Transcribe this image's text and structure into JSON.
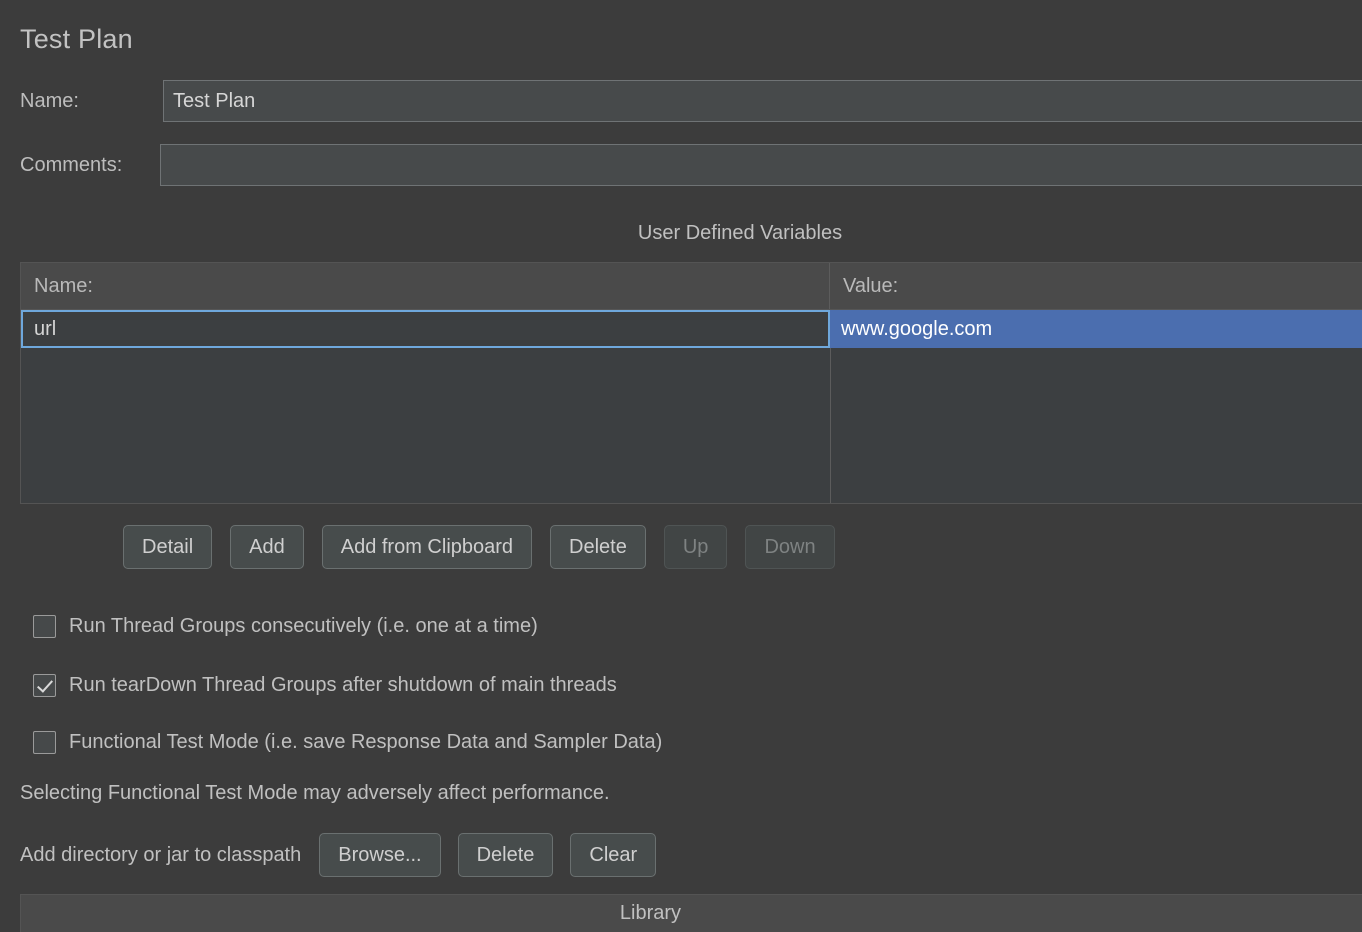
{
  "panel": {
    "title": "Test Plan"
  },
  "fields": {
    "name_label": "Name:",
    "name_value": "Test Plan",
    "comments_label": "Comments:",
    "comments_value": "",
    "comments_placeholder": ""
  },
  "user_defined_variables": {
    "caption": "User Defined Variables",
    "columns": [
      "Name:",
      "Value:"
    ],
    "rows": [
      {
        "name": "url",
        "value": "www.google.com",
        "selected": true
      }
    ],
    "buttons": [
      {
        "label": "Detail",
        "enabled": true
      },
      {
        "label": "Add",
        "enabled": true
      },
      {
        "label": "Add from Clipboard",
        "enabled": true
      },
      {
        "label": "Delete",
        "enabled": true
      },
      {
        "label": "Up",
        "enabled": false
      },
      {
        "label": "Down",
        "enabled": false
      }
    ]
  },
  "options": [
    {
      "label": "Run Thread Groups consecutively (i.e. one at a time)",
      "checked": false
    },
    {
      "label": "Run tearDown Thread Groups after shutdown of main threads",
      "checked": true
    },
    {
      "label": "Functional Test Mode (i.e. save Response Data and Sampler Data)",
      "checked": false
    }
  ],
  "note": "Selecting Functional Test Mode may adversely affect performance.",
  "classpath": {
    "label": "Add directory or jar to classpath",
    "buttons": [
      {
        "label": "Browse...",
        "enabled": true
      },
      {
        "label": "Delete",
        "enabled": true
      },
      {
        "label": "Clear",
        "enabled": true
      }
    ]
  },
  "library_table": {
    "column": "Library"
  },
  "colors": {
    "background": "#3c3c3c",
    "selection": "#4b6eaf",
    "focus_border": "#6fa8dc",
    "header": "#4a4a4a",
    "text": "#c0c0c0"
  }
}
